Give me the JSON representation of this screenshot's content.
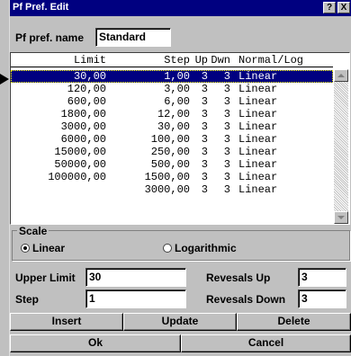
{
  "window": {
    "title": "Pf Pref. Edit",
    "help_btn": "?",
    "close_btn": "X"
  },
  "pref_name": {
    "label": "Pf pref. name",
    "value": "Standard"
  },
  "list": {
    "headers": {
      "limit": "Limit",
      "step": "Step",
      "up": "Up",
      "dwn": "Dwn",
      "type": "Normal/Log"
    },
    "rows": [
      {
        "limit": "30,00",
        "step": "1,00",
        "up": "3",
        "dwn": "3",
        "type": "Linear"
      },
      {
        "limit": "120,00",
        "step": "3,00",
        "up": "3",
        "dwn": "3",
        "type": "Linear"
      },
      {
        "limit": "600,00",
        "step": "6,00",
        "up": "3",
        "dwn": "3",
        "type": "Linear"
      },
      {
        "limit": "1800,00",
        "step": "12,00",
        "up": "3",
        "dwn": "3",
        "type": "Linear"
      },
      {
        "limit": "3000,00",
        "step": "30,00",
        "up": "3",
        "dwn": "3",
        "type": "Linear"
      },
      {
        "limit": "6000,00",
        "step": "100,00",
        "up": "3",
        "dwn": "3",
        "type": "Linear"
      },
      {
        "limit": "15000,00",
        "step": "250,00",
        "up": "3",
        "dwn": "3",
        "type": "Linear"
      },
      {
        "limit": "50000,00",
        "step": "500,00",
        "up": "3",
        "dwn": "3",
        "type": "Linear"
      },
      {
        "limit": "100000,00",
        "step": "1500,00",
        "up": "3",
        "dwn": "3",
        "type": "Linear"
      },
      {
        "limit": "",
        "step": "3000,00",
        "up": "3",
        "dwn": "3",
        "type": "Linear"
      }
    ],
    "selected_row": 1
  },
  "scale": {
    "title": "Scale",
    "options": [
      "Linear",
      "Logarithmic"
    ],
    "selected": "Linear"
  },
  "upper_limit": {
    "label": "Upper Limit",
    "value": "30"
  },
  "step": {
    "label": "Step",
    "value": "1"
  },
  "reversals_up": {
    "label": "Revesals Up",
    "value": "3"
  },
  "reversals_down": {
    "label": "Revesals Down",
    "value": "3"
  },
  "buttons": {
    "insert": "Insert",
    "update": "Update",
    "delete": "Delete",
    "ok": "Ok",
    "cancel": "Cancel"
  },
  "colors": {
    "titlebar": "#000080",
    "face": "#c0c0c0",
    "selection": "#000080"
  }
}
